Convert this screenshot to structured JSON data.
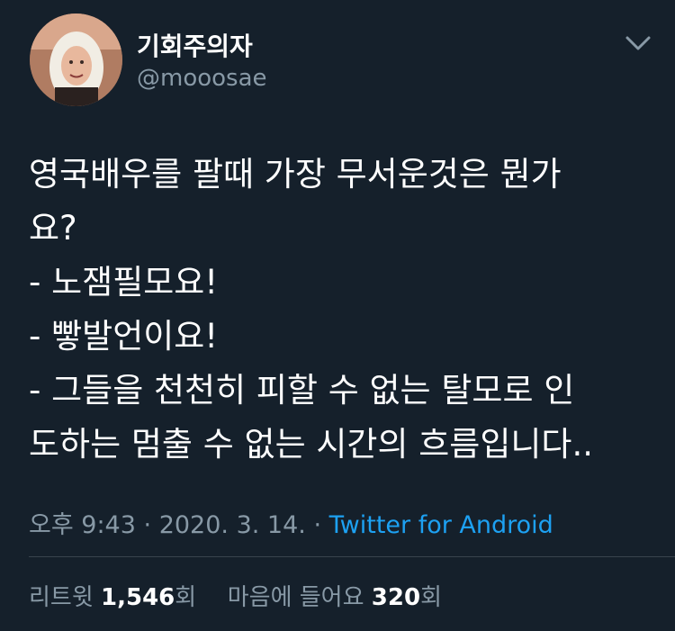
{
  "tweet": {
    "author": {
      "display_name": "기회주의자",
      "handle": "@mooosae",
      "avatar_icon": "profile-photo"
    },
    "menu_icon": "chevron-down-icon",
    "text_lines": [
      "영국배우를 팔때 가장 무서운것은 뭔가",
      "요?",
      "- 노잼필모요!",
      "- 빻발언이요!",
      "- 그들을 천천히 피할 수 없는 탈모로 인",
      "도하는 멈출 수 없는 시간의 흐름입니다.."
    ],
    "time": "오후 9:43",
    "separator": "·",
    "date": "2020. 3. 14.",
    "source": "Twitter for Android",
    "retweets": {
      "label": "리트윗",
      "count": "1,546",
      "suffix": "회"
    },
    "likes": {
      "label": "마음에 들어요",
      "count": "320",
      "suffix": "회"
    }
  },
  "colors": {
    "background": "#15202b",
    "text": "#ffffff",
    "muted": "#8899a6",
    "link": "#1da1f2",
    "divider": "#38444d"
  }
}
